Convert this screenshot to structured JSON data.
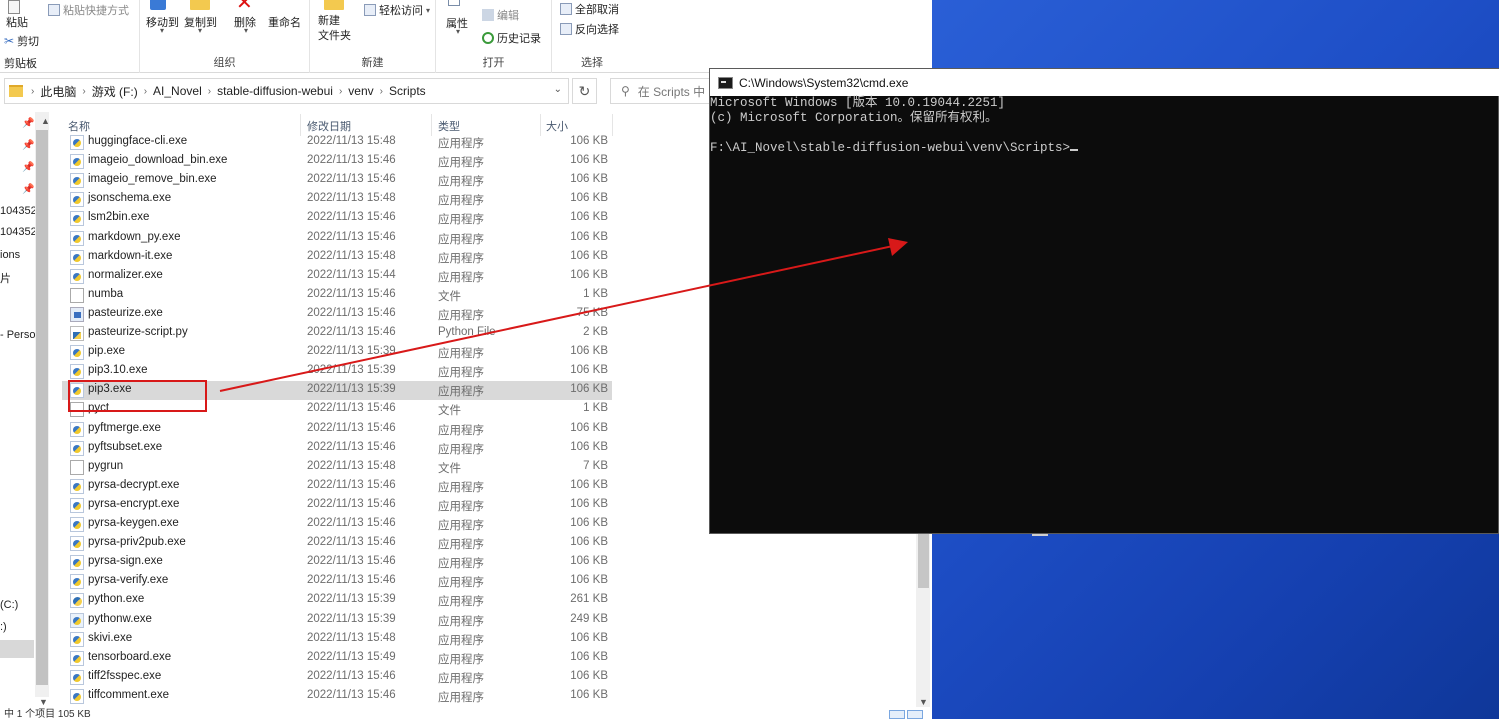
{
  "ribbon": {
    "clipboard": {
      "paste_label": "粘贴",
      "paste_shortcut_label": "粘贴快捷方式",
      "cut_label": "剪切",
      "group_label": "剪贴板"
    },
    "organize": {
      "move_to_label": "移动到",
      "copy_to_label": "复制到",
      "delete_label": "删除",
      "rename_label": "重命名",
      "group_label": "组织"
    },
    "new": {
      "new_folder_label": "新建\n文件夹",
      "easy_access_label": "轻松访问",
      "group_label": "新建"
    },
    "open": {
      "properties_label": "属性",
      "edit_label": "编辑",
      "history_label": "历史记录",
      "group_label": "打开"
    },
    "select": {
      "select_none_label": "全部取消",
      "invert_label": "反向选择",
      "group_label": "选择"
    }
  },
  "address": {
    "crumbs": [
      "此电脑",
      "游戏 (F:)",
      "AI_Novel",
      "stable-diffusion-webui",
      "venv",
      "Scripts"
    ],
    "search_placeholder": "在 Scripts 中"
  },
  "nav": {
    "items": [
      "104352",
      "104352",
      "ions",
      "片",
      "- Perso",
      "(C:)",
      ":)"
    ]
  },
  "columns": {
    "name": "名称",
    "date": "修改日期",
    "type": "类型",
    "size": "大小"
  },
  "files": [
    {
      "name": "huggingface-cli.exe",
      "date": "2022/11/13 15:48",
      "type": "应用程序",
      "size": "106 KB",
      "icon": "exe"
    },
    {
      "name": "imageio_download_bin.exe",
      "date": "2022/11/13 15:46",
      "type": "应用程序",
      "size": "106 KB",
      "icon": "exe"
    },
    {
      "name": "imageio_remove_bin.exe",
      "date": "2022/11/13 15:46",
      "type": "应用程序",
      "size": "106 KB",
      "icon": "exe"
    },
    {
      "name": "jsonschema.exe",
      "date": "2022/11/13 15:48",
      "type": "应用程序",
      "size": "106 KB",
      "icon": "exe"
    },
    {
      "name": "lsm2bin.exe",
      "date": "2022/11/13 15:46",
      "type": "应用程序",
      "size": "106 KB",
      "icon": "exe"
    },
    {
      "name": "markdown_py.exe",
      "date": "2022/11/13 15:46",
      "type": "应用程序",
      "size": "106 KB",
      "icon": "exe"
    },
    {
      "name": "markdown-it.exe",
      "date": "2022/11/13 15:48",
      "type": "应用程序",
      "size": "106 KB",
      "icon": "exe"
    },
    {
      "name": "normalizer.exe",
      "date": "2022/11/13 15:44",
      "type": "应用程序",
      "size": "106 KB",
      "icon": "exe"
    },
    {
      "name": "numba",
      "date": "2022/11/13 15:46",
      "type": "文件",
      "size": "1 KB",
      "icon": "file"
    },
    {
      "name": "pasteurize.exe",
      "date": "2022/11/13 15:46",
      "type": "应用程序",
      "size": "75 KB",
      "icon": "pastr"
    },
    {
      "name": "pasteurize-script.py",
      "date": "2022/11/13 15:46",
      "type": "Python File",
      "size": "2 KB",
      "icon": "pyscript"
    },
    {
      "name": "pip.exe",
      "date": "2022/11/13 15:39",
      "type": "应用程序",
      "size": "106 KB",
      "icon": "exe"
    },
    {
      "name": "pip3.10.exe",
      "date": "2022/11/13 15:39",
      "type": "应用程序",
      "size": "106 KB",
      "icon": "exe"
    },
    {
      "name": "pip3.exe",
      "date": "2022/11/13 15:39",
      "type": "应用程序",
      "size": "106 KB",
      "icon": "exe",
      "selected": true
    },
    {
      "name": "pyct",
      "date": "2022/11/13 15:46",
      "type": "文件",
      "size": "1 KB",
      "icon": "file"
    },
    {
      "name": "pyftmerge.exe",
      "date": "2022/11/13 15:46",
      "type": "应用程序",
      "size": "106 KB",
      "icon": "exe"
    },
    {
      "name": "pyftsubset.exe",
      "date": "2022/11/13 15:46",
      "type": "应用程序",
      "size": "106 KB",
      "icon": "exe"
    },
    {
      "name": "pygrun",
      "date": "2022/11/13 15:48",
      "type": "文件",
      "size": "7 KB",
      "icon": "file"
    },
    {
      "name": "pyrsa-decrypt.exe",
      "date": "2022/11/13 15:46",
      "type": "应用程序",
      "size": "106 KB",
      "icon": "exe"
    },
    {
      "name": "pyrsa-encrypt.exe",
      "date": "2022/11/13 15:46",
      "type": "应用程序",
      "size": "106 KB",
      "icon": "exe"
    },
    {
      "name": "pyrsa-keygen.exe",
      "date": "2022/11/13 15:46",
      "type": "应用程序",
      "size": "106 KB",
      "icon": "exe"
    },
    {
      "name": "pyrsa-priv2pub.exe",
      "date": "2022/11/13 15:46",
      "type": "应用程序",
      "size": "106 KB",
      "icon": "exe"
    },
    {
      "name": "pyrsa-sign.exe",
      "date": "2022/11/13 15:46",
      "type": "应用程序",
      "size": "106 KB",
      "icon": "exe"
    },
    {
      "name": "pyrsa-verify.exe",
      "date": "2022/11/13 15:46",
      "type": "应用程序",
      "size": "106 KB",
      "icon": "exe"
    },
    {
      "name": "python.exe",
      "date": "2022/11/13 15:39",
      "type": "应用程序",
      "size": "261 KB",
      "icon": "py"
    },
    {
      "name": "pythonw.exe",
      "date": "2022/11/13 15:39",
      "type": "应用程序",
      "size": "249 KB",
      "icon": "pyw"
    },
    {
      "name": "skivi.exe",
      "date": "2022/11/13 15:48",
      "type": "应用程序",
      "size": "106 KB",
      "icon": "exe"
    },
    {
      "name": "tensorboard.exe",
      "date": "2022/11/13 15:49",
      "type": "应用程序",
      "size": "106 KB",
      "icon": "exe"
    },
    {
      "name": "tiff2fsspec.exe",
      "date": "2022/11/13 15:46",
      "type": "应用程序",
      "size": "106 KB",
      "icon": "exe"
    },
    {
      "name": "tiffcomment.exe",
      "date": "2022/11/13 15:46",
      "type": "应用程序",
      "size": "106 KB",
      "icon": "exe"
    }
  ],
  "status": {
    "text": "中 1 个项目 105 KB"
  },
  "cmd": {
    "title": "C:\\Windows\\System32\\cmd.exe",
    "lines": [
      "Microsoft Windows [版本 10.0.19044.2251]",
      "(c) Microsoft Corporation。保留所有权利。",
      "",
      "F:\\AI_Novel\\stable-diffusion-webui\\venv\\Scripts>"
    ]
  },
  "colors": {
    "annotation": "#d81919",
    "desktop": "#1e4fc7",
    "selection": "#d9d9d9"
  }
}
